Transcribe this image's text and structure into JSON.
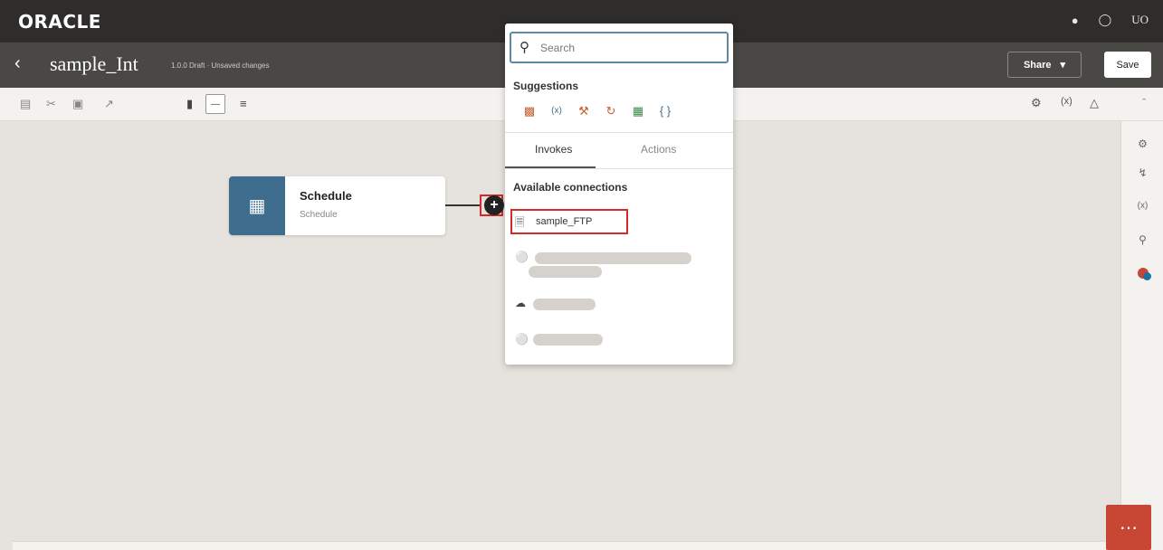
{
  "header": {
    "brand": "ORACLE",
    "icons": [
      "bell-icon",
      "help-icon"
    ],
    "user_initials": "UO"
  },
  "subheader": {
    "back_glyph": "‹",
    "integration_name": "sample_Int",
    "status": "1.0.0 Draft · Unsaved changes",
    "share_label": "Share",
    "save_label": "Save"
  },
  "canvas": {
    "node": {
      "title": "Schedule",
      "subtitle": "Schedule",
      "icon": "calendar-icon"
    },
    "add_glyph": "+"
  },
  "popup": {
    "search_placeholder": "Search",
    "suggestions_title": "Suggestions",
    "suggestion_icons": [
      "mapper-icon",
      "variable-icon",
      "wrench-icon",
      "loop-icon",
      "table-icon",
      "braces-icon"
    ],
    "tabs": [
      {
        "label": "Invokes",
        "active": true
      },
      {
        "label": "Actions",
        "active": false
      }
    ],
    "available_connections_title": "Available connections",
    "connections": [
      {
        "label": "sample_FTP",
        "icon": "ftp-adapter-icon"
      }
    ]
  },
  "colors": {
    "header_bg": "#2f2d2b",
    "subheader_bg": "#4a4845",
    "canvas_bg": "#e6e3de",
    "node_accent": "#3e6d8e",
    "highlight": "#d42a2a",
    "chat_bg": "#c74634"
  }
}
